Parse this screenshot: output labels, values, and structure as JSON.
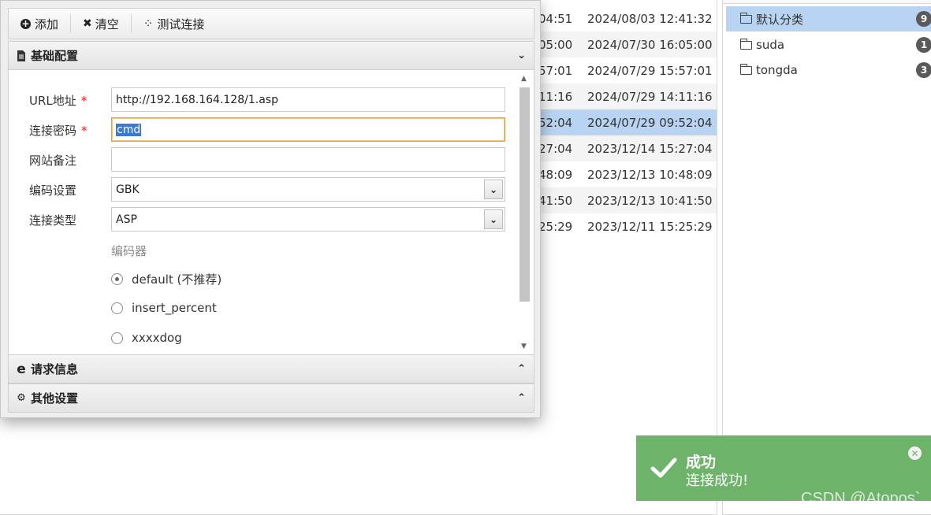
{
  "background_table": {
    "rows": [
      {
        "c1": "04:51",
        "c2": "2024/08/03 12:41:32"
      },
      {
        "c1": "05:00",
        "c2": "2024/07/30 16:05:00"
      },
      {
        "c1": "57:01",
        "c2": "2024/07/29 15:57:01"
      },
      {
        "c1": "11:16",
        "c2": "2024/07/29 14:11:16"
      },
      {
        "c1": "52:04",
        "c2": "2024/07/29 09:52:04"
      },
      {
        "c1": "27:04",
        "c2": "2023/12/14 15:27:04"
      },
      {
        "c1": "48:09",
        "c2": "2023/12/13 10:48:09"
      },
      {
        "c1": "41:50",
        "c2": "2023/12/13 10:41:50"
      },
      {
        "c1": "25:29",
        "c2": "2023/12/11 15:25:29"
      }
    ]
  },
  "categories": [
    {
      "name": "默认分类",
      "count": "9"
    },
    {
      "name": "suda",
      "count": "1"
    },
    {
      "name": "tongda",
      "count": "3"
    }
  ],
  "toolbar": {
    "add_label": "添加",
    "clear_label": "清空",
    "test_label": "测试连接"
  },
  "sections": {
    "basic": "基础配置",
    "request": "请求信息",
    "other": "其他设置"
  },
  "form": {
    "url_label": "URL地址",
    "url_value": "http://192.168.164.128/1.asp",
    "password_label": "连接密码",
    "password_value": "cmd",
    "note_label": "网站备注",
    "note_value": "",
    "encoding_label": "编码设置",
    "encoding_value": "GBK",
    "type_label": "连接类型",
    "type_value": "ASP",
    "required_mark": "*",
    "encoder_label": "编码器",
    "encoders": [
      {
        "label": "default (不推荐)",
        "checked": true
      },
      {
        "label": "insert_percent",
        "checked": false
      },
      {
        "label": "xxxxdog",
        "checked": false
      }
    ]
  },
  "toast": {
    "title": "成功",
    "message": "连接成功!"
  },
  "watermark": "CSDN @Atopos`",
  "colors": {
    "selected_row": "#b9d4f2",
    "toast_bg": "#6db46a",
    "required": "#e02020",
    "focus_border": "#e0a23c"
  }
}
